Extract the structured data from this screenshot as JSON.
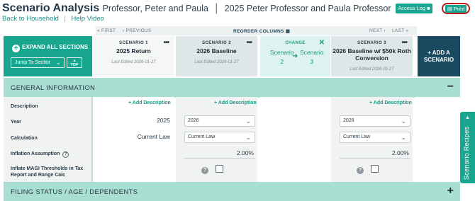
{
  "header": {
    "app_title": "Scenario Analysis",
    "client_name": "Professor, Peter and Paula",
    "plan_name": "2025 Peter Professor and Paula Professor",
    "back_link": "Back to Household",
    "help_link": "Help Video",
    "access_log_label": "Access Log",
    "print_label": "Print"
  },
  "nav": {
    "first": "« FIRST",
    "previous": "‹ PREVIOUS",
    "reorder": "REORDER COLUMNS",
    "next": "NEXT ›",
    "last": "LAST »"
  },
  "controls": {
    "expand_all": "EXPAND ALL SECTIONS",
    "jump_to_section": "Jump To Sectior",
    "top_label": "TOP"
  },
  "scenarios": [
    {
      "label": "SCENARIO 1",
      "name": "2025 Return",
      "edited": "Last Edited 2026-01-27"
    },
    {
      "label": "SCENARIO 2",
      "name": "2026 Baseline",
      "edited": "Last Edited 2026-01-27"
    },
    {
      "label": "SCENARIO 3",
      "name": "2026 Baseline w/ $50k Roth Conversion",
      "edited": "Last Edited 2026-01-27"
    }
  ],
  "change_column": {
    "label": "CHANGE",
    "from_word": "Scenario",
    "from_num": "2",
    "to_word": "Scenario",
    "to_num": "3"
  },
  "add_scenario_label": "+ ADD A SCENARIO",
  "sections": {
    "general": "GENERAL INFORMATION",
    "filing": "FILING STATUS / AGE / DEPENDENTS",
    "collapse_symbol": "−",
    "expand_symbol": "+"
  },
  "rows": {
    "description": "Description",
    "year": "Year",
    "calculation": "Calculation",
    "inflation": "Inflation Assumption",
    "inflate_magi": "Inflate MAGI Thresholds in Tax Report and Range Calc"
  },
  "cells": {
    "add_description": "+ Add Description",
    "s1_year": "2025",
    "s1_calc": "Current Law",
    "s2_year": "2026",
    "s2_calc": "Current Law",
    "s2_inflation": "2.00%",
    "s3_year": "2026",
    "s3_calc": "Current Law",
    "s3_inflation": "2.00%"
  },
  "side_tab": "Scenario Recipes",
  "colors": {
    "accent": "#19a68f",
    "section_bg": "#a9ded3",
    "dark_navy": "#1a4a60",
    "print_ring": "#c4151c"
  }
}
